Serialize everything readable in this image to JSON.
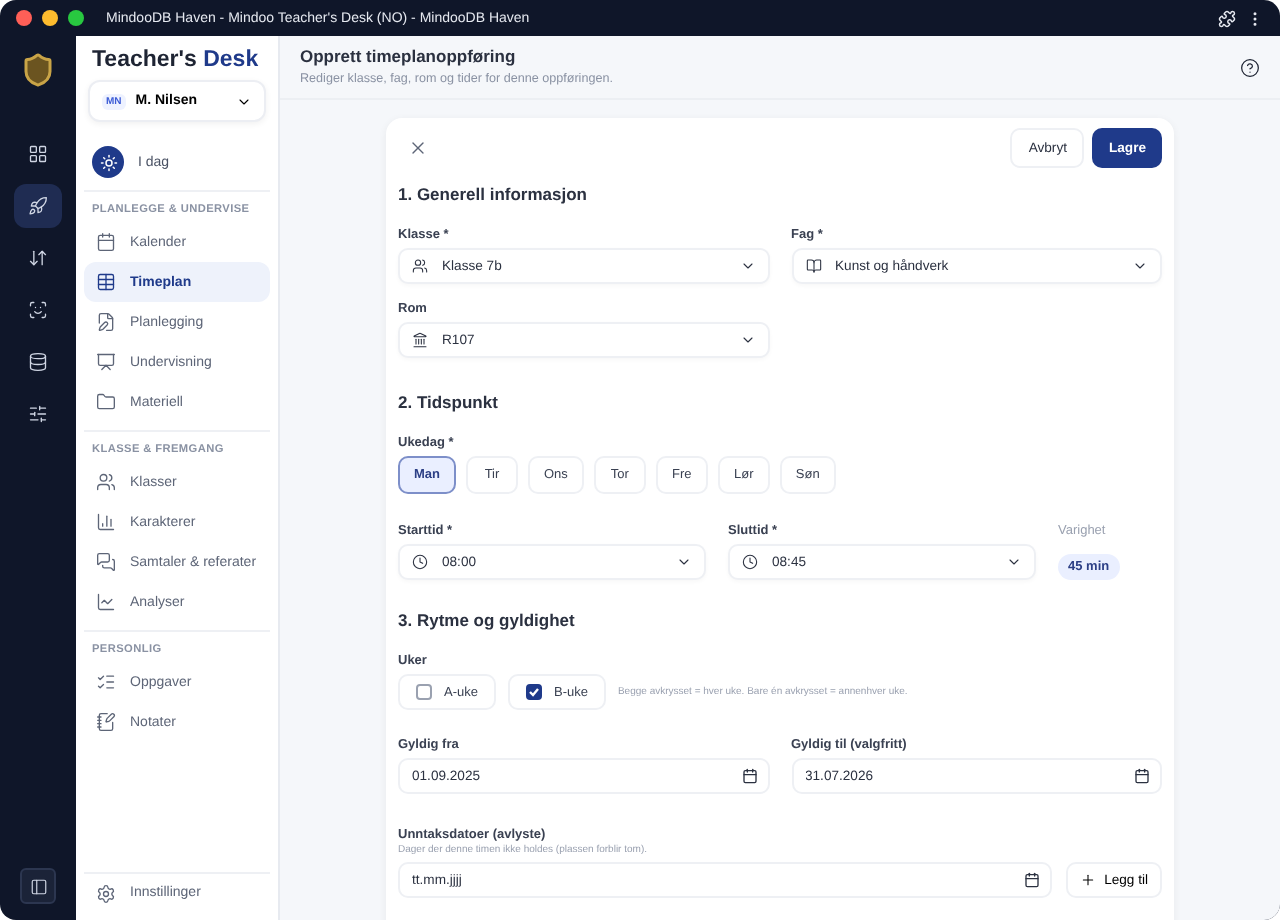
{
  "window": {
    "title": "MindooDB Haven - Mindoo Teacher's Desk (NO) - MindooDB Haven"
  },
  "rail": {
    "items": [
      {
        "selected": false
      },
      {
        "selected": true
      },
      {
        "selected": false
      },
      {
        "selected": false
      },
      {
        "selected": false
      },
      {
        "selected": false
      }
    ]
  },
  "sidebar": {
    "brand": {
      "first": "Teacher's",
      "accent": "Desk"
    },
    "user": {
      "initials": "MN",
      "name": "M. Nilsen"
    },
    "today": "I dag",
    "sections": [
      {
        "title": "PLANLEGGE & UNDERVISE",
        "items": [
          {
            "label": "Kalender",
            "selected": false
          },
          {
            "label": "Timeplan",
            "selected": true
          },
          {
            "label": "Planlegging",
            "selected": false
          },
          {
            "label": "Undervisning",
            "selected": false
          },
          {
            "label": "Materiell",
            "selected": false
          }
        ]
      },
      {
        "title": "KLASSE & FREMGANG",
        "items": [
          {
            "label": "Klasser",
            "selected": false
          },
          {
            "label": "Karakterer",
            "selected": false
          },
          {
            "label": "Samtaler & referater",
            "selected": false
          },
          {
            "label": "Analyser",
            "selected": false
          }
        ]
      },
      {
        "title": "PERSONLIG",
        "items": [
          {
            "label": "Oppgaver",
            "selected": false
          },
          {
            "label": "Notater",
            "selected": false
          }
        ]
      }
    ],
    "settings": "Innstillinger"
  },
  "header": {
    "title": "Opprett timeplanoppføring",
    "subtitle": "Rediger klasse, fag, rom og tider for denne oppføringen."
  },
  "form": {
    "buttons": {
      "cancel": "Avbryt",
      "save": "Lagre"
    },
    "general": {
      "title": "1. Generell informasjon",
      "class": {
        "label": "Klasse *",
        "value": "Klasse 7b"
      },
      "subject": {
        "label": "Fag *",
        "value": "Kunst og håndverk"
      },
      "room": {
        "label": "Rom",
        "value": "R107"
      }
    },
    "time": {
      "title": "2. Tidspunkt",
      "weekday_label": "Ukedag *",
      "weekdays": [
        {
          "label": "Man",
          "selected": true
        },
        {
          "label": "Tir",
          "selected": false
        },
        {
          "label": "Ons",
          "selected": false
        },
        {
          "label": "Tor",
          "selected": false
        },
        {
          "label": "Fre",
          "selected": false
        },
        {
          "label": "Lør",
          "selected": false
        },
        {
          "label": "Søn",
          "selected": false
        }
      ],
      "start": {
        "label": "Starttid *",
        "value": "08:00"
      },
      "end": {
        "label": "Sluttid *",
        "value": "08:45"
      },
      "duration": {
        "label": "Varighet",
        "value": "45 min"
      }
    },
    "rhythm": {
      "title": "3. Rytme og gyldighet",
      "weeks_label": "Uker",
      "weeks": [
        {
          "label": "A-uke",
          "checked": false
        },
        {
          "label": "B-uke",
          "checked": true
        }
      ],
      "weeks_hint": "Begge avkrysset = hver uke. Bare én avkrysset = annenhver uke.",
      "valid_from": {
        "label": "Gyldig fra",
        "value": "01.09.2025"
      },
      "valid_to": {
        "label": "Gyldig til (valgfritt)",
        "value": "31.07.2026"
      },
      "exceptions": {
        "label": "Unntaksdatoer (avlyste)",
        "hint": "Dager der denne timen ikke holdes (plassen forblir tom).",
        "placeholder": "tt.mm.jjjj",
        "add": "Legg til"
      }
    }
  }
}
